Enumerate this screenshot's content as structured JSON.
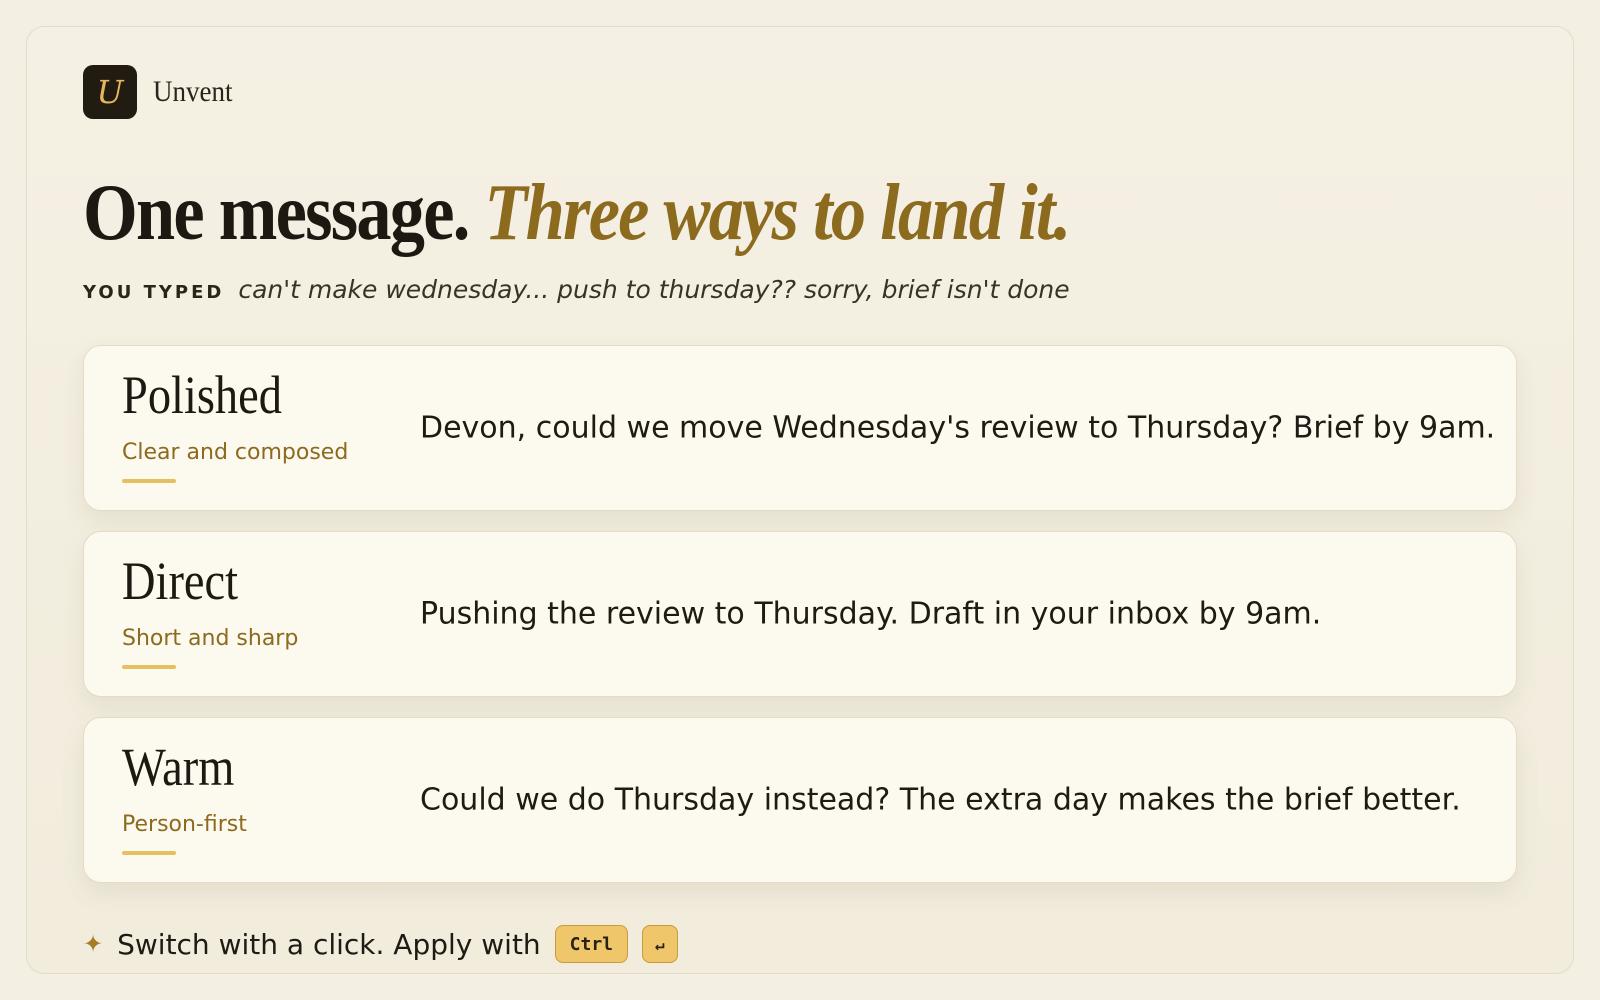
{
  "brand": {
    "logo_letter": "U",
    "name": "Unvent"
  },
  "headline": {
    "plain": "One message.",
    "accent": "Three ways to land it."
  },
  "typed": {
    "label": "YOU TYPED",
    "text": "can't make wednesday... push to thursday?? sorry, brief isn't done"
  },
  "options": [
    {
      "title": "Polished",
      "subtitle": "Clear and composed",
      "message": "Devon, could we move Wednesday's review to Thursday? Brief by 9am."
    },
    {
      "title": "Direct",
      "subtitle": "Short and sharp",
      "message": "Pushing the review to Thursday. Draft in your inbox by 9am."
    },
    {
      "title": "Warm",
      "subtitle": "Person-first",
      "message": "Could we do Thursday instead? The extra day makes the brief better."
    }
  ],
  "footer": {
    "icon": "sparkle-icon",
    "text": "Switch with a click. Apply with",
    "key_ctrl": "Ctrl",
    "key_enter": "↵"
  },
  "colors": {
    "accent": "#8c6a1e",
    "underline": "#e6bf60",
    "key_bg": "#efc66a",
    "logo_bg": "#211b12",
    "background": "#f3efe2",
    "card_bg": "#fcf9ef"
  }
}
